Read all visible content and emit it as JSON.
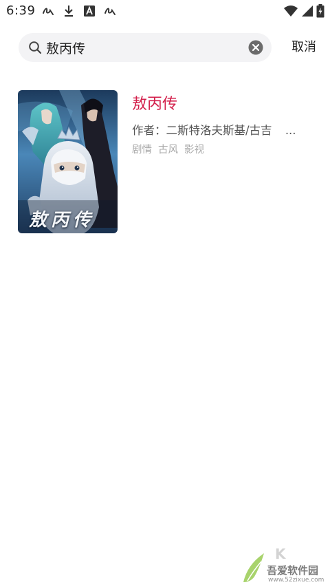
{
  "status_bar": {
    "time": "6:39",
    "left_icons": [
      "notification-scribble-icon",
      "download-icon",
      "font-a-icon",
      "notification-scribble-icon"
    ],
    "right_icons": [
      "wifi-icon",
      "cellular-signal-icon",
      "battery-charging-icon"
    ]
  },
  "search": {
    "query": "敖丙传",
    "cancel_label": "取消"
  },
  "results": [
    {
      "title": "敖丙传",
      "author": "作者：二斯特洛夫斯基/古吉",
      "author_ellipsis": "...",
      "tags": [
        "剧情",
        "古风",
        "影视"
      ],
      "cover_title": "敖丙传"
    }
  ],
  "watermark": {
    "brand": "吾爱软件园",
    "url": "www.52zixue.com"
  },
  "colors": {
    "accent": "#d31f4b",
    "search_bg": "#f3f3f5",
    "tag_color": "#a9a9a9"
  }
}
